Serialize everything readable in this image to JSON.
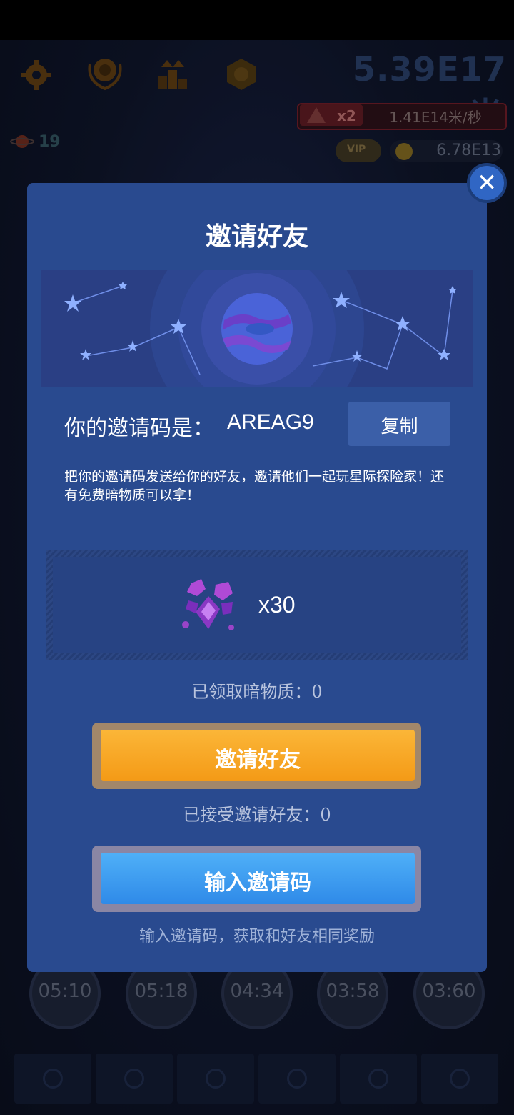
{
  "hud": {
    "distance": "5.39E17米",
    "rate_multiplier": "x2",
    "rate": "1.41E14米/秒",
    "vip_label": "VIP",
    "coins": "6.78E13",
    "level": "19"
  },
  "timers": [
    "05:10",
    "05:18",
    "04:34",
    "03:58",
    "03:60"
  ],
  "dialog": {
    "close_symbol": "✕",
    "title": "邀请好友",
    "code_label": "你的邀请码是：",
    "code_value": "AREAG9",
    "copy_label": "复制",
    "description": "把你的邀请码发送给你的好友，邀请他们一起玩星际探险家！还有免费暗物质可以拿！",
    "reward_quantity": "x30",
    "claimed_text": "已领取暗物质：0",
    "invite_button": "邀请好友",
    "accepted_text": "已接受邀请好友：0",
    "enter_code_button": "输入邀请码",
    "hint": "输入邀请码，获取和好友相同奖励"
  },
  "colors": {
    "dialog_bg": "#294a8f",
    "invite_button": "#f7a51c",
    "enter_code_button": "#3d9bf0"
  },
  "icons": [
    "gear-icon",
    "trophy-icon",
    "leaderboard-icon",
    "badge-icon",
    "planet-icon",
    "dark-matter-crystal-icon",
    "rocket-nav-icon",
    "atom-nav-icon",
    "key-nav-icon",
    "orbit-nav-icon",
    "radar-nav-icon",
    "settings-nav-icon"
  ]
}
